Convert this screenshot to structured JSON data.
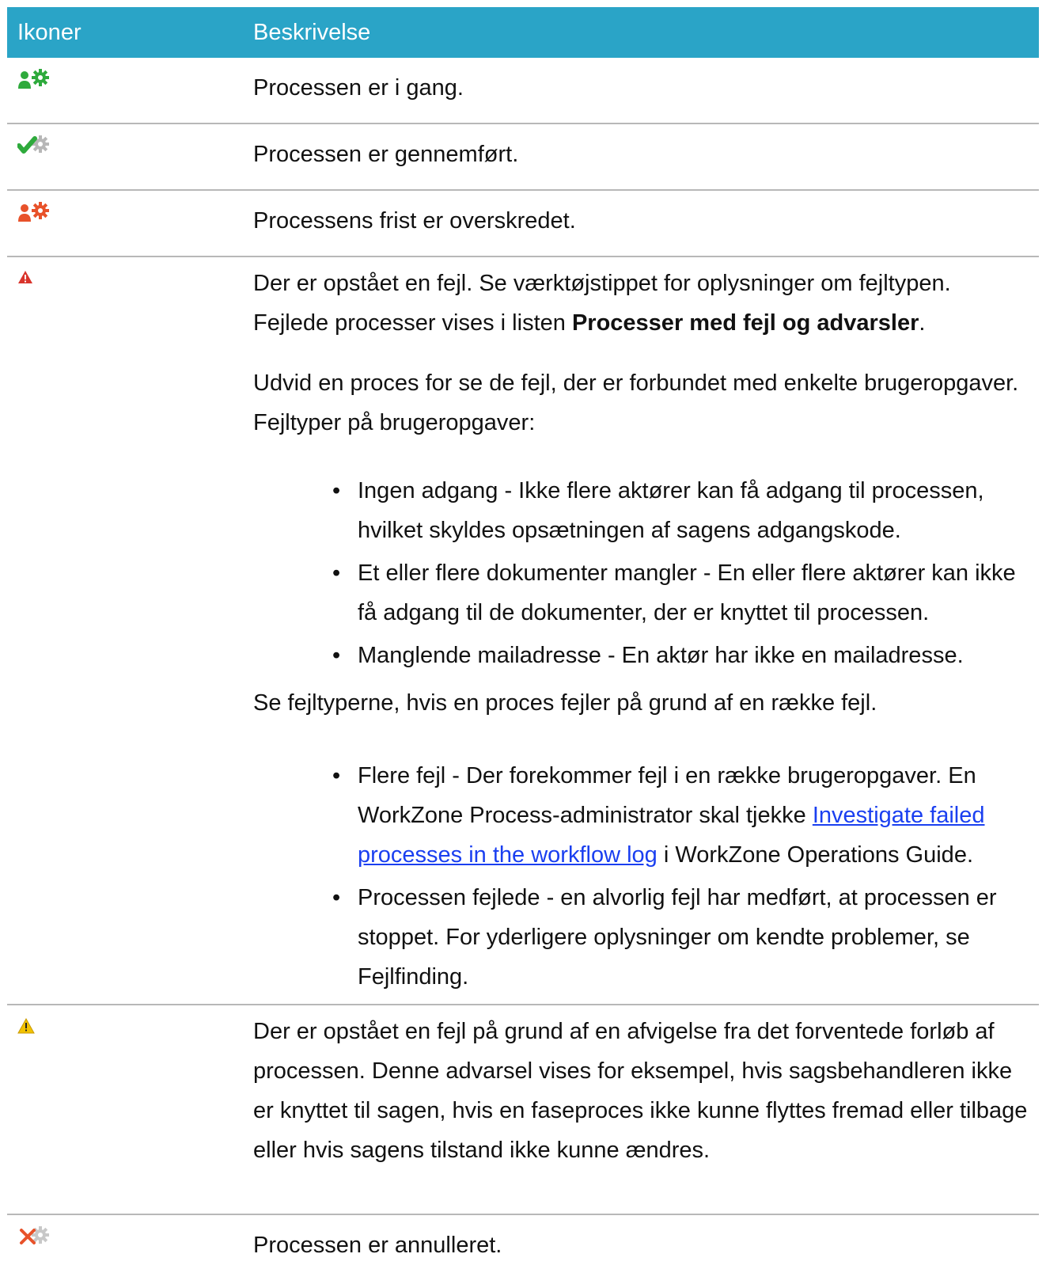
{
  "header": {
    "col_icons": "Ikoner",
    "col_description": "Beskrivelse"
  },
  "rows": [
    {
      "icon": "process-running-icon",
      "text": "Processen er i gang."
    },
    {
      "icon": "process-completed-icon",
      "text": "Processen er gennemført."
    },
    {
      "icon": "process-overdue-icon",
      "text": "Processens frist er overskredet."
    },
    {
      "icon": "error-triangle-icon",
      "p1_text": "Der er opstået en fejl. Se værktøjstippet for oplysninger om fejltypen. Fejlede processer vises i listen ",
      "p1_bold": "Processer med fejl og advarsler",
      "p1_end": ".",
      "p2": "Udvid en proces for se de fejl, der er forbundet med enkelte brugeropgaver. Fejltyper på brugeropgaver:",
      "bullets1": [
        "Ingen adgang - Ikke flere aktører kan få adgang til processen, hvilket skyldes opsætningen af sagens adgangskode.",
        "Et eller flere dokumenter mangler - En eller flere aktører kan ikke få adgang til de dokumenter, der er knyttet til processen.",
        "Manglende mailadresse - En aktør har ikke en mailadresse."
      ],
      "p3": "Se fejltyperne, hvis en proces fejler på grund af en række fejl.",
      "bullet_multi_prefix": "Flere fejl - Der forekommer fejl i en række brugeropgaver. En WorkZone Process-administrator skal tjekke ",
      "bullet_multi_link": "Investigate failed processes in the workflow log",
      "bullet_multi_suffix": " i WorkZone Operations Guide.",
      "bullet_failed": "Processen fejlede - en alvorlig fejl har medført, at processen er stoppet. For yderligere oplysninger om kendte problemer, se Fejlfinding."
    },
    {
      "icon": "warning-triangle-icon",
      "text": "Der er opstået en fejl på grund af en afvigelse fra det forventede forløb af processen. Denne advarsel vises for eksempel, hvis sagsbehandleren ikke er knyttet til sagen, hvis en faseproces ikke kunne flyttes fremad eller tilbage eller hvis sagens tilstand ikke kunne ændres."
    },
    {
      "icon": "process-cancelled-icon",
      "text": "Processen er annulleret."
    }
  ],
  "colors": {
    "header_bg": "#2aa4c7",
    "header_text": "#ffffff",
    "divider": "#b8b8b8",
    "link": "#1a3ff0",
    "running_green": "#2eaa3c",
    "overdue_orange": "#e8522a",
    "error_red": "#d9342b",
    "warning_yellow": "#f2c200"
  }
}
